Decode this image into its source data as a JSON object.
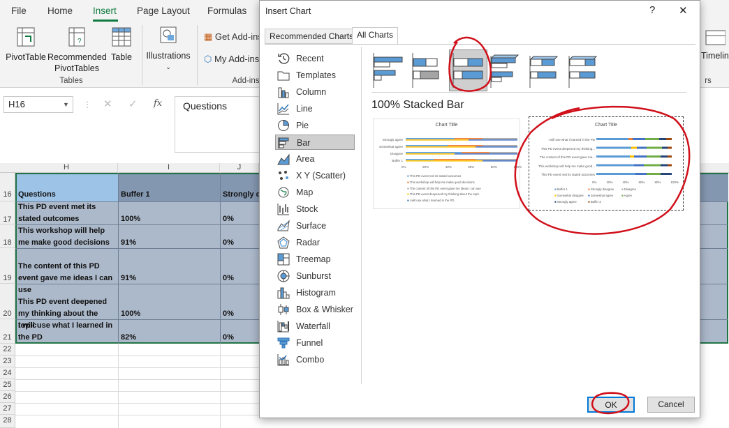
{
  "ribbon": {
    "tabs": [
      "File",
      "Home",
      "Insert",
      "Page Layout",
      "Formulas"
    ],
    "buttons": {
      "pivottable": "PivotTable",
      "recommended": "Recommended",
      "pivottables": "PivotTables",
      "table": "Table",
      "illustrations": "Illustrations",
      "get_addins": "Get Add-ins",
      "my_addins": "My Add-ins",
      "timeline": "Timeline"
    },
    "groups": {
      "tables": "Tables",
      "addins": "Add-ins",
      "filters": "rs"
    }
  },
  "formula_bar": {
    "name_box": "H16",
    "formula": "Questions"
  },
  "grid": {
    "columns": [
      "H",
      "I",
      "J"
    ],
    "rows": [
      "16",
      "17",
      "18",
      "19",
      "20",
      "21",
      "22",
      "23",
      "24",
      "25",
      "26",
      "27",
      "28"
    ],
    "headers": [
      "Questions",
      "Buffer 1",
      "Strongly di"
    ],
    "data": [
      {
        "q": "This PD event met its stated outcomes",
        "b": "100%",
        "s": "0%"
      },
      {
        "q": "This workshop will help me make good decisions",
        "b": "91%",
        "s": "0%"
      },
      {
        "q": "The content of this PD event gave me ideas I can use",
        "b": "91%",
        "s": "0%"
      },
      {
        "q": "This PD event deepened my thinking about the topic",
        "b": "100%",
        "s": "0%"
      },
      {
        "q": "I will use what I learned in the PD",
        "b": "82%",
        "s": "0%"
      }
    ]
  },
  "dialog": {
    "title": "Insert Chart",
    "help": "?",
    "close": "✕",
    "tabs": [
      "Recommended Charts",
      "All Charts"
    ],
    "chart_types": [
      "Recent",
      "Templates",
      "Column",
      "Line",
      "Pie",
      "Bar",
      "Area",
      "X Y (Scatter)",
      "Map",
      "Stock",
      "Surface",
      "Radar",
      "Treemap",
      "Sunburst",
      "Histogram",
      "Box & Whisker",
      "Waterfall",
      "Funnel",
      "Combo"
    ],
    "selected_type": "Bar",
    "subtype_title": "100% Stacked Bar",
    "preview1": {
      "title": "Chart Title",
      "cats": [
        "Strongly agree",
        "Somewhat agree",
        "Disagree",
        "Buffer 1"
      ],
      "ticks": [
        "0%",
        "20%",
        "40%",
        "60%",
        "80%",
        "100%"
      ],
      "legend": [
        "This PD event met its stated outcomes",
        "This workshop will help me make good decisions",
        "The content of this PD event gave me ideas I can use",
        "This PD event deepened my thinking about the topic",
        "I will use what I learned in the PD"
      ]
    },
    "preview2": {
      "title": "Chart Title",
      "cats": [
        "I will use what I learned in the PD",
        "This PD event deepened my thinking...",
        "The content of this PD event gave me...",
        "This workshop will help me make good...",
        "This PD event met its stated outcomes"
      ],
      "ticks": [
        "0%",
        "20%",
        "40%",
        "60%",
        "80%",
        "100%"
      ],
      "legend": [
        "Buffer 1",
        "Strongly disagree",
        "Disagree",
        "Somewhat disagree",
        "Somewhat agree",
        "Agree",
        "Strongly agree",
        "Buffer 2"
      ]
    },
    "ok": "OK",
    "cancel": "Cancel"
  },
  "colors": {
    "accent": "#107c41",
    "header_fill": "#9dc3e6",
    "cell_fill": "#acb9ca",
    "annotation": "#d0101a",
    "bar_blue": "#5b9bd5",
    "bar_orange": "#ed7d31",
    "bar_gray": "#a5a5a5",
    "bar_yellow": "#ffc000",
    "bar_dblue": "#4472c4",
    "bar_green": "#70ad47"
  }
}
